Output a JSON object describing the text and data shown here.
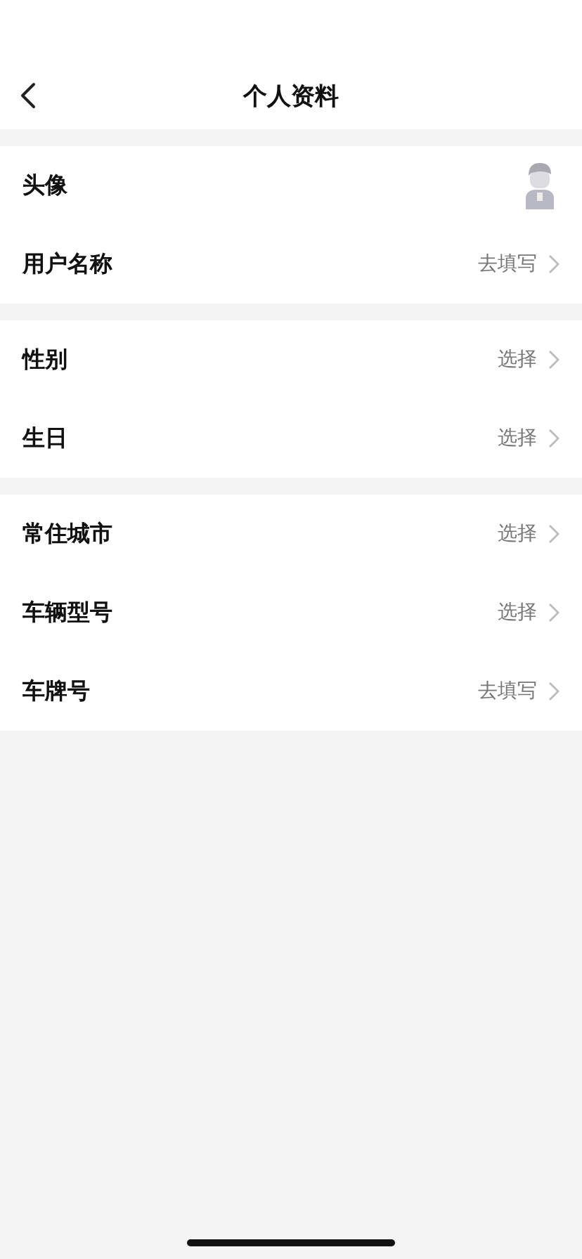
{
  "nav": {
    "title": "个人资料"
  },
  "sections": [
    {
      "rows": [
        {
          "kind": "avatar",
          "label": "头像"
        },
        {
          "kind": "value",
          "label": "用户名称",
          "value": "去填写"
        }
      ]
    },
    {
      "rows": [
        {
          "kind": "value",
          "label": "性别",
          "value": "选择"
        },
        {
          "kind": "value",
          "label": "生日",
          "value": "选择"
        }
      ]
    },
    {
      "rows": [
        {
          "kind": "value",
          "label": "常住城市",
          "value": "选择"
        },
        {
          "kind": "value",
          "label": "车辆型号",
          "value": "选择"
        },
        {
          "kind": "value",
          "label": "车牌号",
          "value": "去填写"
        }
      ]
    }
  ]
}
